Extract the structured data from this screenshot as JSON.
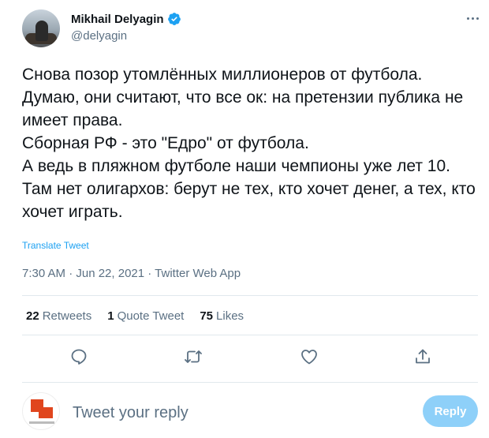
{
  "author": {
    "display_name": "Mikhail Delyagin",
    "handle": "@delyagin",
    "verified": true
  },
  "tweet": {
    "lines": [
      "Снова позор утомлённых миллионеров от футбола.",
      "Думаю, они считают, что все ок: на претензии публика не имеет права.",
      "Сборная РФ - это \"Едро\" от футбола.",
      "А ведь в пляжном футболе наши чемпионы уже лет 10.",
      "Там нет олигархов: берут не тех, кто хочет денег, а тех, кто хочет играть."
    ],
    "translate_label": "Translate Tweet",
    "timestamp": "7:30 AM · Jun 22, 2021 · Twitter Web App"
  },
  "stats": {
    "retweets_count": "22",
    "retweets_label": "Retweets",
    "quote_count": "1",
    "quote_label": "Quote Tweet",
    "likes_count": "75",
    "likes_label": "Likes"
  },
  "actions": {
    "icons": [
      "reply-icon",
      "retweet-icon",
      "like-icon",
      "share-icon"
    ]
  },
  "composer": {
    "placeholder": "Tweet your reply",
    "reply_label": "Reply"
  },
  "colors": {
    "accent": "#1da1f2",
    "reply_button_disabled": "#8ed0f9",
    "secondary_text": "#5b7083"
  }
}
